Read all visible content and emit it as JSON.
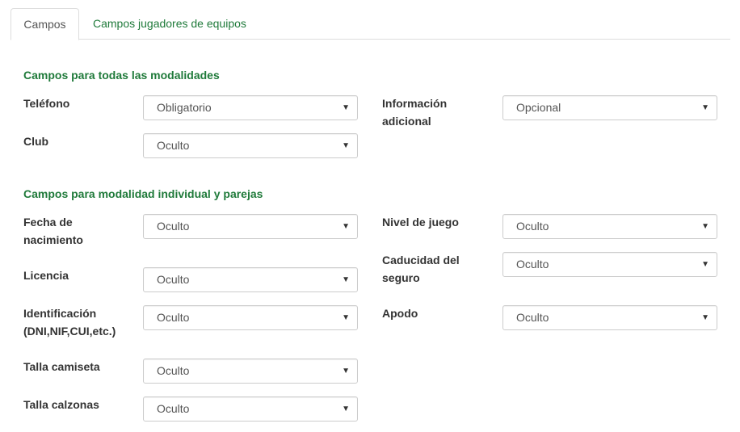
{
  "tabs": [
    {
      "label": "Campos",
      "active": true
    },
    {
      "label": "Campos jugadores de equipos",
      "active": false
    }
  ],
  "section_all": {
    "title": "Campos para todas las modalidades",
    "fields": {
      "telefono": {
        "label": "Teléfono",
        "value": "Obligatorio"
      },
      "info_adicional": {
        "label": "Información adicional",
        "value": "Opcional"
      },
      "club": {
        "label": "Club",
        "value": "Oculto"
      }
    }
  },
  "section_individual": {
    "title": "Campos para modalidad individual y parejas",
    "fields": {
      "fecha_nacimiento": {
        "label": "Fecha de nacimiento",
        "value": "Oculto"
      },
      "nivel_juego": {
        "label": "Nivel de juego",
        "value": "Oculto"
      },
      "licencia": {
        "label": "Licencia",
        "value": "Oculto"
      },
      "caducidad_seguro": {
        "label": "Caducidad del seguro",
        "value": "Oculto"
      },
      "identificacion": {
        "label": "Identificación (DNI,NIF,CUI,etc.)",
        "value": "Oculto"
      },
      "apodo": {
        "label": "Apodo",
        "value": "Oculto"
      },
      "talla_camiseta": {
        "label": "Talla camiseta",
        "value": "Oculto"
      },
      "talla_calzonas": {
        "label": "Talla calzonas",
        "value": "Oculto"
      }
    }
  },
  "icons": {
    "caret": "▼"
  },
  "colors": {
    "accent_green": "#1f7a3a",
    "border": "#cccccc",
    "tab_border": "#dddddd"
  }
}
